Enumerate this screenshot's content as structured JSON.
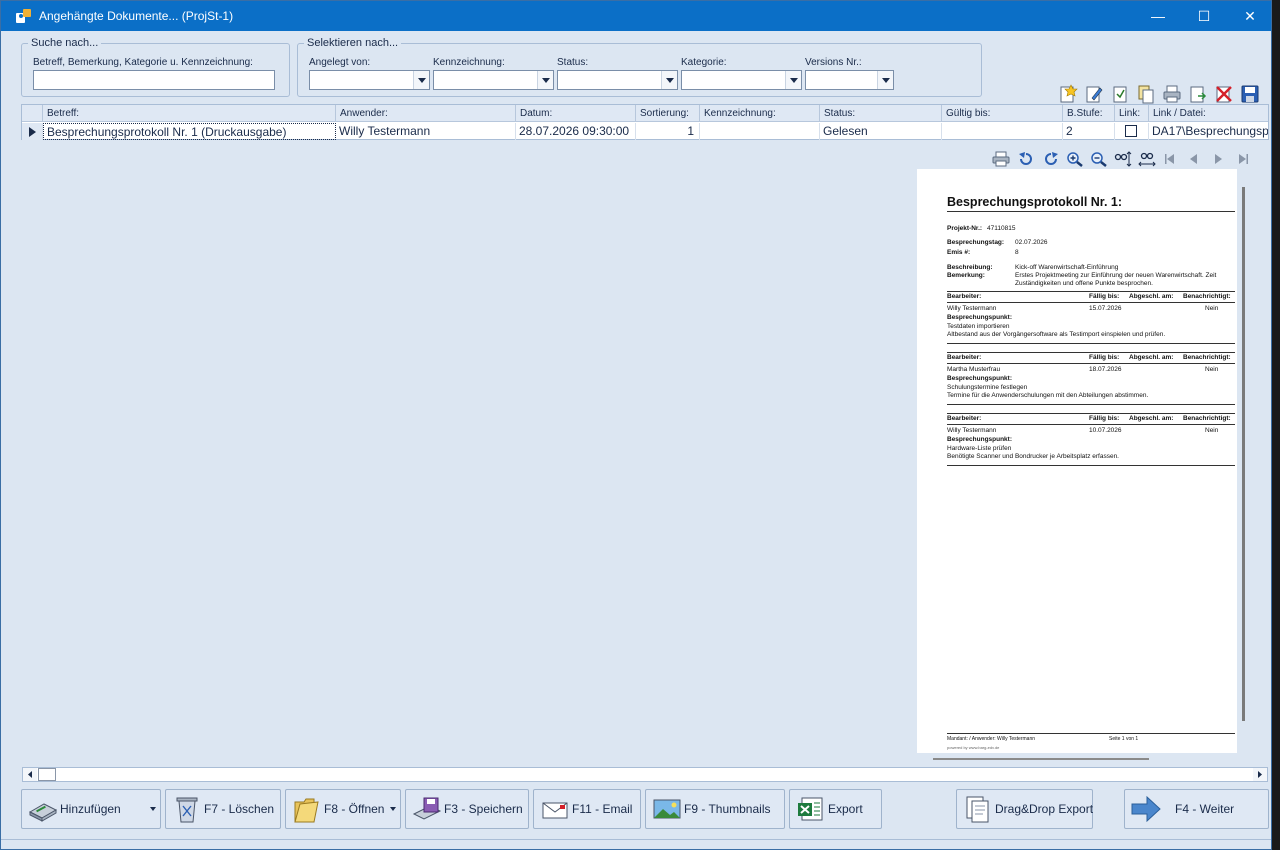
{
  "window": {
    "title": "Angehängte Dokumente... (ProjSt-1)",
    "minimize": "—",
    "maximize": "☐",
    "close": "✕"
  },
  "search": {
    "group_title": "Suche nach...",
    "label": "Betreff, Bemerkung, Kategorie u. Kennzeichnung:",
    "value": ""
  },
  "select": {
    "group_title": "Selektieren nach...",
    "angelegt_label": "Angelegt von:",
    "kennzeichnung_label": "Kennzeichnung:",
    "status_label": "Status:",
    "kategorie_label": "Kategorie:",
    "version_label": "Versions Nr.:"
  },
  "grid": {
    "headers": [
      "Betreff:",
      "Anwender:",
      "Datum:",
      "Sortierung:",
      "Kennzeichnung:",
      "Status:",
      "Gültig bis:",
      "B.Stufe:",
      "Link:",
      "Link / Datei:"
    ],
    "row": {
      "betreff": "Besprechungsprotokoll Nr. 1 (Druckausgabe)",
      "anwender": "Willy Testermann",
      "datum": "28.07.2026 09:30:00",
      "sortierung": "1",
      "kennzeichnung": "",
      "status": "Gelesen",
      "gueltig": "",
      "bstufe": "2",
      "link_checked": false,
      "datei": "DA17\\Besprechungsp"
    }
  },
  "document": {
    "title": "Besprechungsprotokoll Nr. 1:",
    "projekt_label": "Projekt-Nr.:",
    "projekt_value": "47110815",
    "tag_label": "Besprechungstag:",
    "tag_value": "02.07.2026",
    "emis_label": "Emis #:",
    "emis_value": "8",
    "beschreibung_label": "Beschreibung:",
    "beschreibung_value": "Kick-off Warenwirtschaft-Einführung",
    "bemerkung_label": "Bemerkung:",
    "bemerkung_line1": "Erstes Projektmeeting zur Einführung der neuen Warenwirtschaft. Zeit",
    "bemerkung_line2": "Zuständigkeiten und offene Punkte besprochen.",
    "col_bearbeiter": "Bearbeiter:",
    "col_faellig": "Fällig bis:",
    "col_abgeschl": "Abgeschl. am:",
    "col_benach": "Benachrichtigt:",
    "punkt_label": "Besprechungspunkt:",
    "items": [
      {
        "bearbeiter": "Willy Testermann",
        "faellig": "15.07.2026",
        "benach": "Nein",
        "punkt": "Testdaten importieren",
        "detail": "Altbestand aus der Vorgängersoftware als Testimport einspielen und prüfen."
      },
      {
        "bearbeiter": "Martha Musterfrau",
        "faellig": "18.07.2026",
        "benach": "Nein",
        "punkt": "Schulungstermine festlegen",
        "detail": "Termine für die Anwenderschulungen mit den Abteilungen abstimmen."
      },
      {
        "bearbeiter": "Willy Testermann",
        "faellig": "10.07.2026",
        "benach": "Nein",
        "punkt": "Hardware-Liste prüfen",
        "detail": "Benötigte Scanner und Bondrucker je Arbeitsplatz erfassen."
      }
    ],
    "footer_left": "Mandant:  / Anwender: Willy Testermann",
    "footer_right": "Seite 1 von 1",
    "footer_small": "powered by www.barg-edv.de"
  },
  "buttons": {
    "add": "Hinzufügen",
    "delete": "F7 - Löschen",
    "open": "F8 - Öffnen",
    "save": "F3 - Speichern",
    "email": "F11 - Email",
    "thumbs": "F9 - Thumbnails",
    "export": "Export",
    "dragdrop": "Drag&Drop Export",
    "next": "F4 - Weiter"
  },
  "colors": {
    "titlebar": "#0b6fc7",
    "window_bg": "#dce6f2",
    "text": "#1a2b4a"
  }
}
